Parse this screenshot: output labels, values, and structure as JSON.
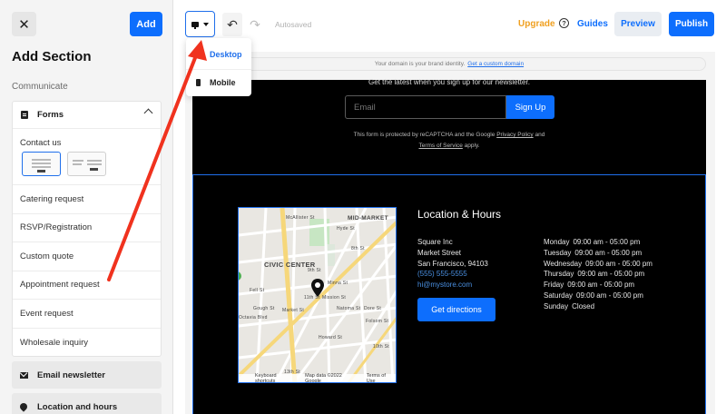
{
  "sidebar": {
    "close_label": "✕",
    "add_label": "Add",
    "title": "Add Section",
    "category": "Communicate",
    "forms": {
      "label": "Forms",
      "contact_label": "Contact us",
      "items": [
        "Catering request",
        "RSVP/Registration",
        "Custom quote",
        "Appointment request",
        "Event request",
        "Wholesale inquiry"
      ]
    },
    "email_newsletter": "Email newsletter",
    "location_hours": "Location and hours"
  },
  "toolbar": {
    "autosaved": "Autosaved",
    "upgrade": "Upgrade",
    "help": "?",
    "guides": "Guides",
    "preview": "Preview",
    "publish": "Publish"
  },
  "device_menu": {
    "desktop": "Desktop",
    "mobile": "Mobile"
  },
  "domain_bar": {
    "text": "Your domain is your brand identity.",
    "link": "Get a custom domain"
  },
  "newsletter": {
    "heading": "Get the latest when you sign up for our newsletter.",
    "email_placeholder": "Email",
    "signup": "Sign Up",
    "recaptcha_1": "This form is protected by reCAPTCHA and the Google",
    "privacy": "Privacy Policy",
    "and": "and",
    "terms": "Terms of Service",
    "apply": "apply."
  },
  "location": {
    "title": "Location & Hours",
    "address": [
      "Square Inc",
      "Market Street",
      "San Francisco,  94103"
    ],
    "phone": "(555) 555-5555",
    "email": "hi@mystore.com",
    "directions": "Get directions",
    "hours": [
      {
        "day": "Monday",
        "time": "09:00 am - 05:00 pm"
      },
      {
        "day": "Tuesday",
        "time": "09:00 am - 05:00 pm"
      },
      {
        "day": "Wednesday",
        "time": "09:00 am - 05:00 pm"
      },
      {
        "day": "Thursday",
        "time": "09:00 am - 05:00 pm"
      },
      {
        "day": "Friday",
        "time": "09:00 am - 05:00 pm"
      },
      {
        "day": "Saturday",
        "time": "09:00 am - 05:00 pm"
      },
      {
        "day": "Sunday",
        "time": "Closed"
      }
    ]
  },
  "map": {
    "labels": [
      "MID-MARKET",
      "CIVIC CENTER",
      "McAllister St",
      "Hyde St",
      "Fell St",
      "Market St",
      "9th St",
      "8th St",
      "Mission St",
      "Howard St",
      "Folsom St",
      "10th St",
      "Gough St",
      "Octavia Blvd",
      "11th St",
      "Dore St",
      "Natoma St",
      "Minna St",
      "13th St"
    ],
    "keyboard": "Keyboard shortcuts",
    "mapdata": "Map data ©2022 Google",
    "terms": "Terms of Use"
  },
  "colors": {
    "accent": "#0d6efd",
    "upgrade": "#f0a020",
    "annotation_arrow": "#f0321e"
  },
  "icons": [
    "close-icon",
    "form-icon",
    "chevron-up-icon",
    "mail-icon",
    "location-pin-icon",
    "monitor-icon",
    "caret-down-icon",
    "undo-icon",
    "redo-icon",
    "help-icon",
    "phone-icon",
    "map-pin-icon"
  ]
}
